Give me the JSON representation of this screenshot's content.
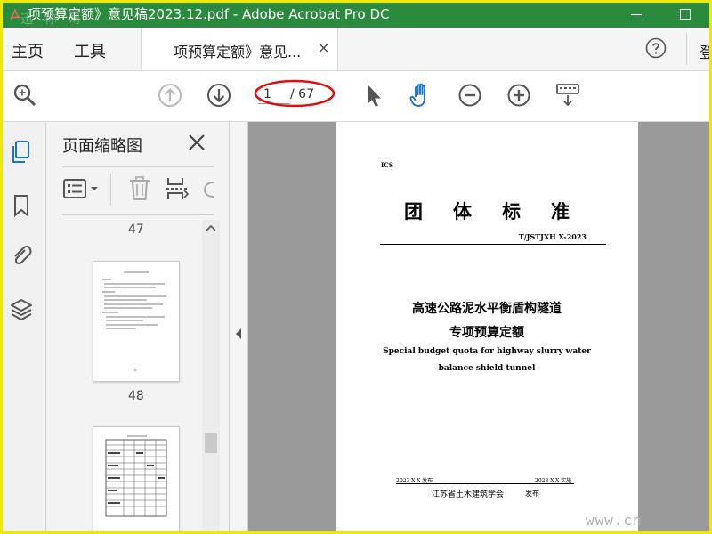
{
  "window": {
    "title": "项预算定额》意见稿2023.12.pdf - Adobe Acrobat Pro DC",
    "watermark_text": "迅 称 网"
  },
  "menubar": {
    "home": "主页",
    "tools": "工具",
    "tab_label": "项预算定额》意见...",
    "tab_close": "×",
    "login": "登"
  },
  "toolbar": {
    "current_page": "1",
    "total_pages": "/ 67",
    "icons": [
      "search-icon",
      "prev-page-icon",
      "next-page-icon",
      "select-arrow-icon",
      "hand-icon",
      "zoom-out-icon",
      "zoom-in-icon",
      "keyboard-icon"
    ]
  },
  "thumbnails": {
    "panel_title": "页面缩略图",
    "labels": [
      "47",
      "48"
    ]
  },
  "document": {
    "ics": "ICS",
    "standard_title": "团体标准",
    "code": "T/JSTJXH X-2023",
    "title_line1": "高速公路泥水平衡盾构隧道",
    "title_line2": "专项预算定额",
    "en_line1": "Special budget quota for highway slurry water",
    "en_line2": "balance shield tunnel",
    "release_date": "2023-X-X 发布",
    "effective_date": "2023-X-X 实施",
    "organization": "江苏省土木建筑学会",
    "publish": "发布"
  },
  "corner_watermark": "www.cn",
  "colors": {
    "titlebar": "#2a8a3e",
    "accent_blue": "#1a73c8",
    "annotation_red": "#e01010",
    "frame_yellow": "#f0e800"
  }
}
